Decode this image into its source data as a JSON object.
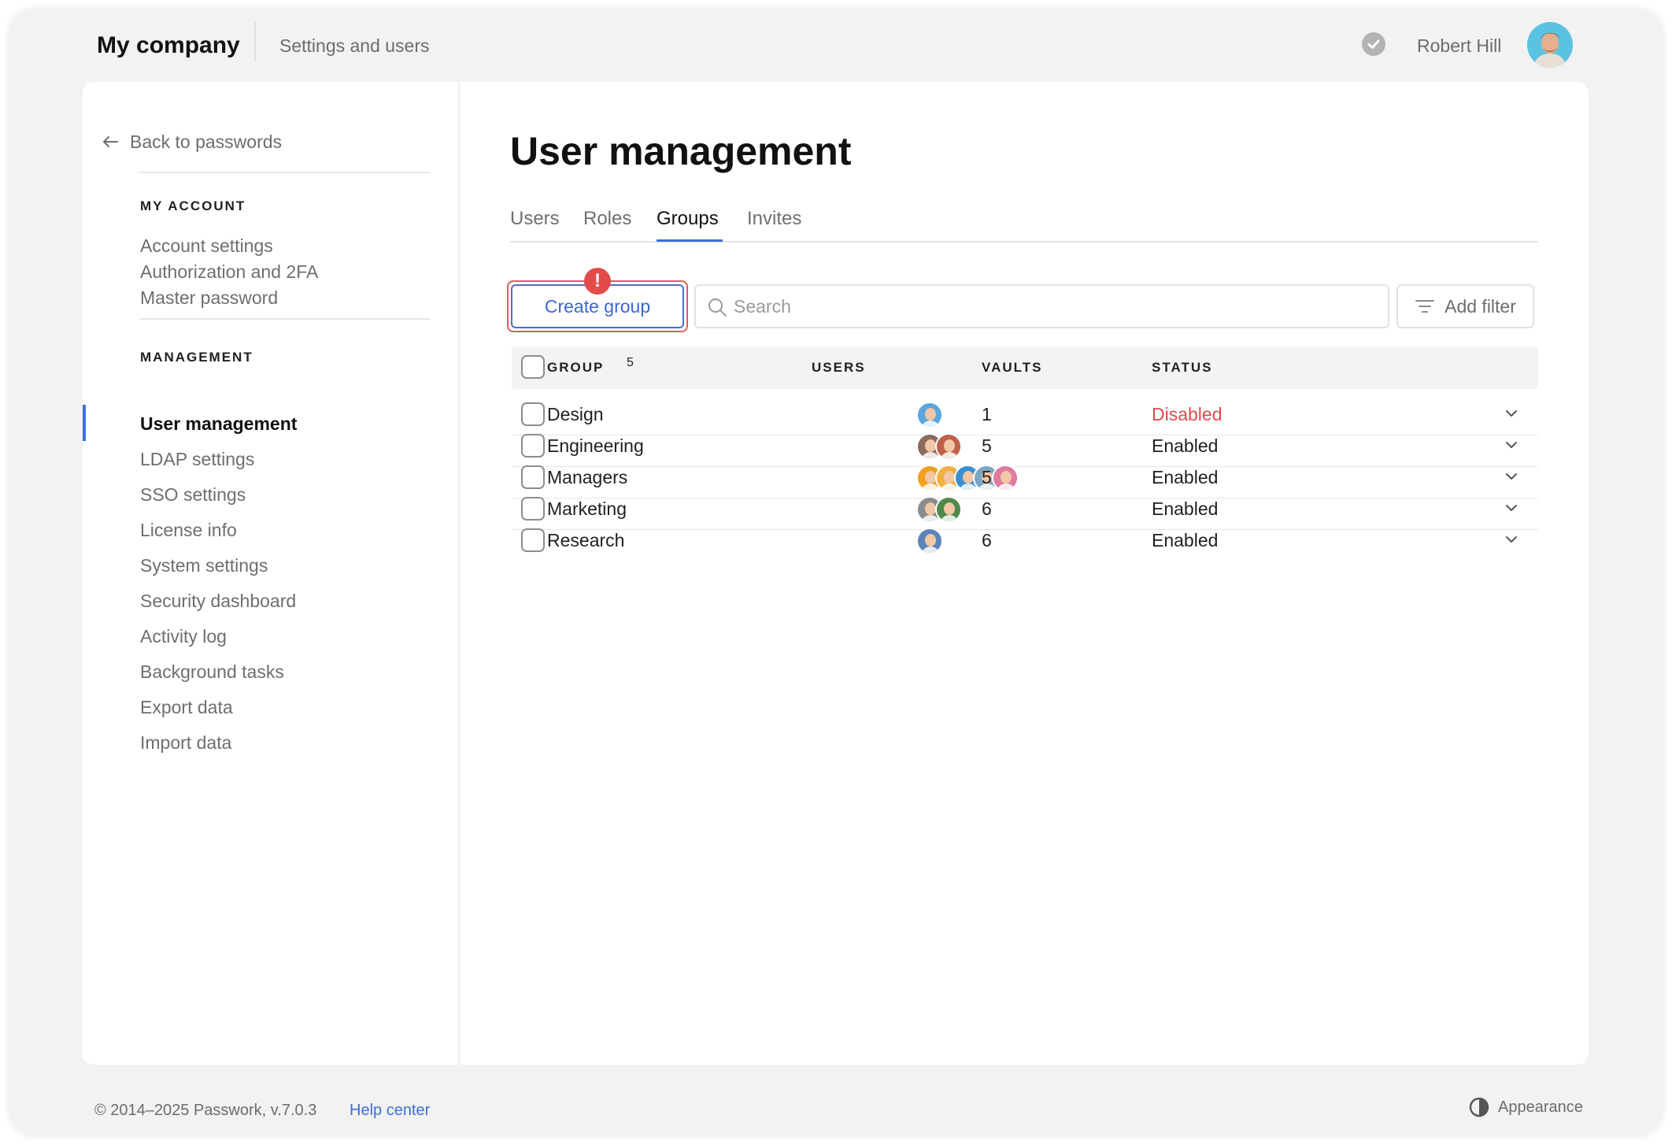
{
  "header": {
    "brand": "My company",
    "breadcrumb": "Settings and users",
    "user_name": "Robert Hill"
  },
  "sidebar": {
    "back_label": "Back to passwords",
    "sections": [
      {
        "label": "MY ACCOUNT",
        "items": [
          "Account settings",
          "Authorization and 2FA",
          "Master password"
        ]
      },
      {
        "label": "MANAGEMENT",
        "items": [
          "User management",
          "LDAP settings",
          "SSO settings",
          "License info",
          "System settings",
          "Security dashboard",
          "Activity log",
          "Background tasks",
          "Export data",
          "Import data"
        ]
      }
    ],
    "active_item": "User management"
  },
  "main": {
    "title": "User management",
    "tabs": [
      "Users",
      "Roles",
      "Groups",
      "Invites"
    ],
    "active_tab": "Groups",
    "create_label": "Create group",
    "alert_glyph": "!",
    "search_placeholder": "Search",
    "filter_label": "Add filter",
    "table": {
      "headers": {
        "group": "GROUP",
        "group_count": "5",
        "users": "USERS",
        "vaults": "VAULTS",
        "status": "STATUS"
      },
      "rows": [
        {
          "group": "Design",
          "vaults": "1",
          "status": "Disabled",
          "avatars": [
            "#5aa7de"
          ]
        },
        {
          "group": "Engineering",
          "vaults": "5",
          "status": "Enabled",
          "avatars": [
            "#8b6a5e",
            "#c0604a"
          ]
        },
        {
          "group": "Managers",
          "vaults": "5",
          "status": "Enabled",
          "avatars": [
            "#f0a020",
            "#f0b040",
            "#3c8fd0",
            "#7aa6c8",
            "#e07aa0"
          ]
        },
        {
          "group": "Marketing",
          "vaults": "6",
          "status": "Enabled",
          "avatars": [
            "#8c8c8c",
            "#4f8a4a"
          ]
        },
        {
          "group": "Research",
          "vaults": "6",
          "status": "Enabled",
          "avatars": [
            "#5b84b8"
          ]
        }
      ]
    }
  },
  "footer": {
    "copyright": "© 2014–2025 Passwork, v.7.0.3",
    "help": "Help center",
    "appearance": "Appearance"
  },
  "colors": {
    "accent": "#3c70d8",
    "danger": "#e04a4a",
    "alert_outline": "#e55a5a"
  }
}
